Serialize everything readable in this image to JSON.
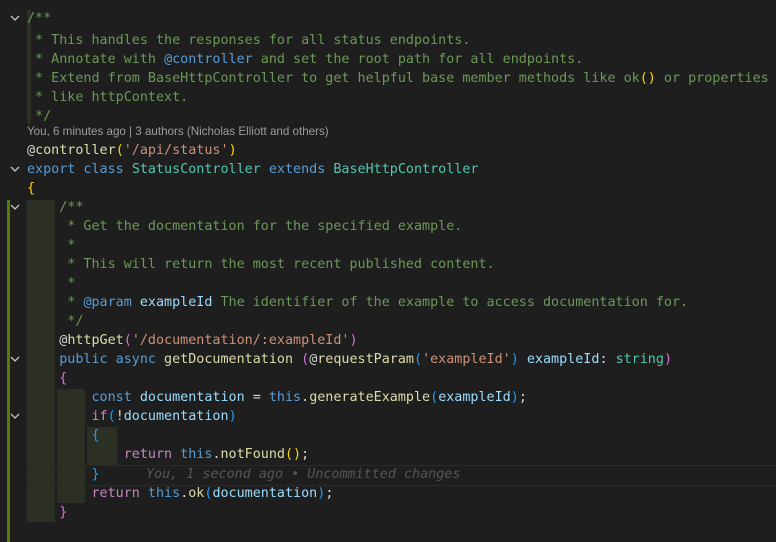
{
  "editor": {
    "blame_text": "You, 6 minutes ago | 3 authors (Nicholas Elliott and others)",
    "ghost_text": "You, 1 second ago • Uncommitted changes",
    "lines": [
      {
        "id": "l1",
        "text": "/**"
      },
      {
        "id": "l2",
        "text": " * This handles the responses for all status endpoints."
      },
      {
        "id": "l3",
        "text": " * Annotate with @controller and set the root path for all endpoints."
      },
      {
        "id": "l4",
        "text": " * Extend from BaseHttpController to get helpful base member methods like ok() or properties"
      },
      {
        "id": "l5",
        "text": " * like httpContext."
      },
      {
        "id": "l6",
        "text": " */"
      },
      {
        "id": "l7",
        "text": "@controller('/api/status')"
      },
      {
        "id": "l8",
        "text": "export class StatusController extends BaseHttpController"
      },
      {
        "id": "l9",
        "text": "{"
      },
      {
        "id": "l10",
        "text": "    /**"
      },
      {
        "id": "l11",
        "text": "     * Get the docmentation for the specified example."
      },
      {
        "id": "l12",
        "text": "     *"
      },
      {
        "id": "l13",
        "text": "     * This will return the most recent published content."
      },
      {
        "id": "l14",
        "text": "     *"
      },
      {
        "id": "l15",
        "text": "     * @param exampleId The identifier of the example to access documentation for."
      },
      {
        "id": "l16",
        "text": "     */"
      },
      {
        "id": "l17",
        "text": "    @httpGet('/documentation/:exampleId')"
      },
      {
        "id": "l18",
        "text": "    public async getDocumentation (@requestParam('exampleId') exampleId: string)"
      },
      {
        "id": "l19",
        "text": "    {"
      },
      {
        "id": "l20",
        "text": "        const documentation = this.generateExample(exampleId);"
      },
      {
        "id": "l21",
        "text": "        if(!documentation)"
      },
      {
        "id": "l22",
        "text": "        {"
      },
      {
        "id": "l23",
        "text": "            return this.notFound();"
      },
      {
        "id": "l24",
        "text": "        }"
      },
      {
        "id": "l25",
        "text": "        return this.ok(documentation);"
      },
      {
        "id": "l26",
        "text": "    }"
      }
    ]
  },
  "colors": {
    "background": "#1e1e1e",
    "comment": "#6a9955",
    "keyword": "#569cd6",
    "control": "#c586c0",
    "class": "#4ec9b0",
    "function": "#dcdcaa",
    "string": "#ce9178",
    "variable": "#9cdcfe"
  },
  "icons": {
    "fold": "chevron-down-icon"
  }
}
